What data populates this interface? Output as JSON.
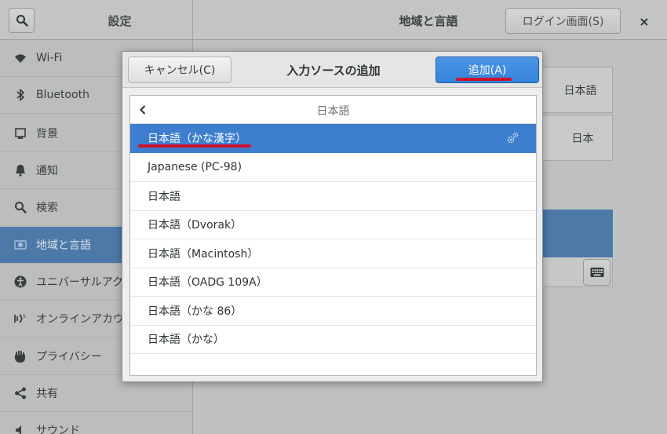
{
  "headerbar": {
    "sidebar_title": "設定",
    "title": "地域と言語",
    "login_button": "ログイン画面(S)",
    "close": "×"
  },
  "sidebar": {
    "items": [
      {
        "label": "Wi-Fi",
        "icon": "wifi-icon"
      },
      {
        "label": "Bluetooth",
        "icon": "bluetooth-icon"
      },
      {
        "label": "背景",
        "icon": "background-icon"
      },
      {
        "label": "通知",
        "icon": "bell-icon"
      },
      {
        "label": "検索",
        "icon": "search-icon"
      },
      {
        "label": "地域と言語",
        "icon": "region-icon",
        "selected": true
      },
      {
        "label": "ユニバーサルアク",
        "icon": "accessibility-icon"
      },
      {
        "label": "オンラインアカウ",
        "icon": "online-accounts-icon"
      },
      {
        "label": "プライバシー",
        "icon": "privacy-hand-icon"
      },
      {
        "label": "共有",
        "icon": "share-icon"
      },
      {
        "label": "サウンド",
        "icon": "sound-icon"
      }
    ]
  },
  "main": {
    "language_value": "日本語",
    "formats_value": "日本"
  },
  "dialog": {
    "cancel": "キャンセル(C)",
    "title": "入力ソースの追加",
    "add": "追加(A)",
    "list_title": "日本語",
    "items": [
      {
        "label": "日本語（かな漢字）",
        "selected": true,
        "has_settings": true
      },
      {
        "label": "Japanese (PC-98)"
      },
      {
        "label": "日本語"
      },
      {
        "label": "日本語（Dvorak）"
      },
      {
        "label": "日本語（Macintosh）"
      },
      {
        "label": "日本語（OADG 109A）"
      },
      {
        "label": "日本語（かな 86）"
      },
      {
        "label": "日本語（かな）"
      }
    ]
  },
  "colors": {
    "accent": "#3d7fce",
    "annotation_underline": "#d0112b"
  }
}
